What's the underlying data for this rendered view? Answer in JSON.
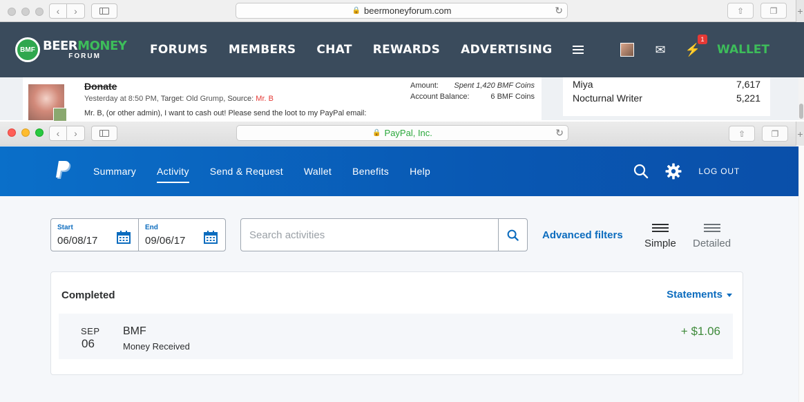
{
  "back_browser": {
    "url": "beermoneyforum.com"
  },
  "bmf": {
    "logo": {
      "part1": "BEER",
      "part2": "MONEY",
      "sub": "FORUM",
      "badge": "BMF"
    },
    "menu": [
      "FORUMS",
      "MEMBERS",
      "CHAT",
      "REWARDS",
      "ADVERTISING"
    ],
    "notification_count": "1",
    "wallet_label": "WALLET",
    "post": {
      "title": "Donate",
      "meta_time": "Yesterday at 8:50 PM,",
      "meta_target_label": "Target:",
      "meta_target": "Old Grump",
      "meta_source_label": "Source:",
      "meta_source": "Mr. B",
      "text": "Mr. B, (or other admin), I want to cash out! Please send the loot to my PayPal email:",
      "amount_label": "Amount:",
      "amount_value": "Spent 1,420 BMF Coins",
      "balance_label": "Account Balance:",
      "balance_value": "6 BMF Coins"
    },
    "leaderboard": [
      {
        "name": "Miya",
        "value": "7,617"
      },
      {
        "name": "Nocturnal Writer",
        "value": "5,221"
      }
    ]
  },
  "front_browser": {
    "url": "PayPal, Inc."
  },
  "paypal": {
    "nav": [
      {
        "label": "Summary",
        "active": false
      },
      {
        "label": "Activity",
        "active": true
      },
      {
        "label": "Send & Request",
        "active": false
      },
      {
        "label": "Wallet",
        "active": false
      },
      {
        "label": "Benefits",
        "active": false
      },
      {
        "label": "Help",
        "active": false
      }
    ],
    "logout_label": "LOG OUT",
    "filters": {
      "start_label": "Start",
      "start_value": "06/08/17",
      "end_label": "End",
      "end_value": "09/06/17",
      "search_placeholder": "Search activities",
      "advanced_label": "Advanced filters",
      "simple_label": "Simple",
      "detailed_label": "Detailed"
    },
    "completed": {
      "title": "Completed",
      "statements_label": "Statements",
      "transactions": [
        {
          "month": "SEP",
          "day": "06",
          "name": "BMF",
          "type": "Money Received",
          "amount": "+ $1.06"
        }
      ]
    },
    "colors": {
      "header": "#0958b3",
      "link": "#0c6cbe",
      "positive": "#3e8a3a"
    }
  }
}
